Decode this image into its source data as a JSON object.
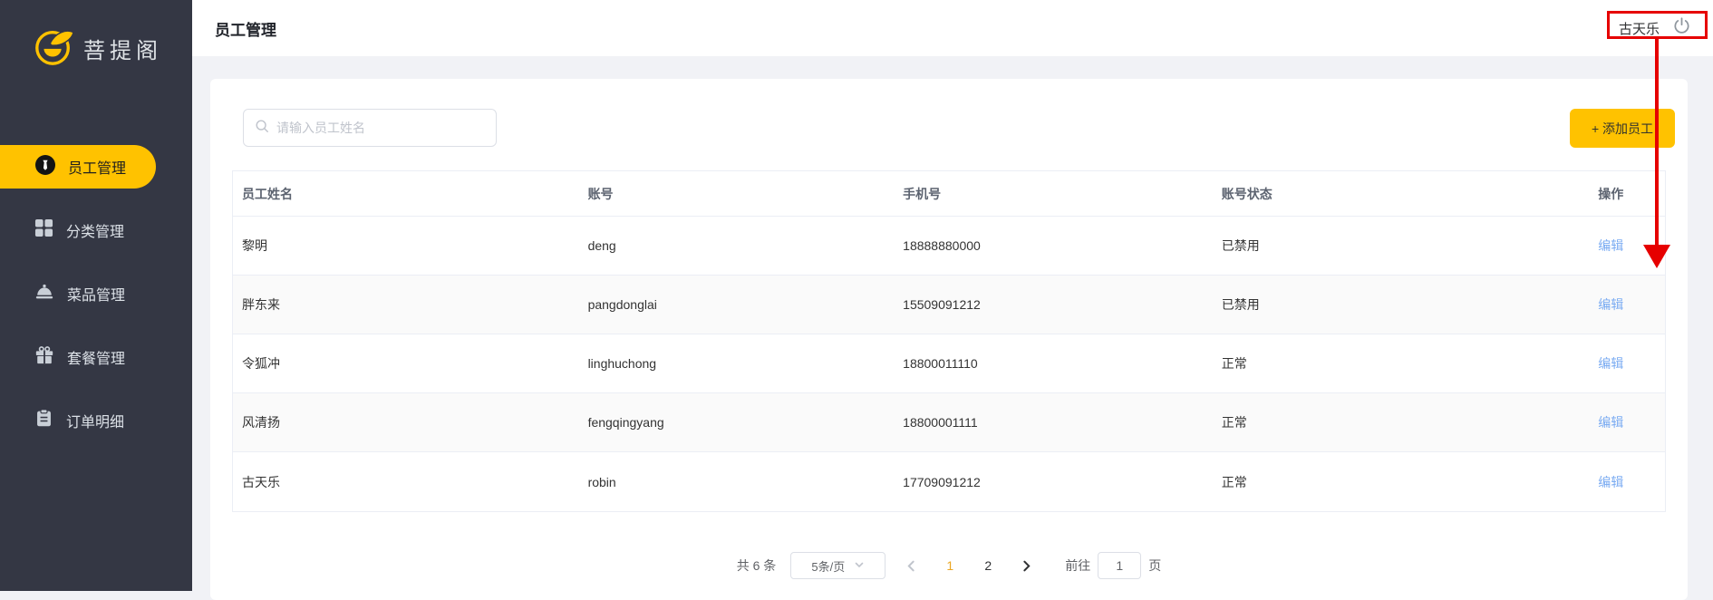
{
  "sidebar": {
    "logo_text": "菩提阁",
    "items": [
      {
        "label": "员工管理",
        "icon": "employee-icon",
        "active": true
      },
      {
        "label": "分类管理",
        "icon": "category-grid-icon",
        "active": false
      },
      {
        "label": "菜品管理",
        "icon": "dish-icon",
        "active": false
      },
      {
        "label": "套餐管理",
        "icon": "combo-gift-icon",
        "active": false
      },
      {
        "label": "订单明细",
        "icon": "order-clipboard-icon",
        "active": false
      }
    ]
  },
  "header": {
    "title": "员工管理",
    "user_name": "古天乐",
    "logout_icon": "power-icon"
  },
  "toolbar": {
    "search_placeholder": "请输入员工姓名",
    "search_icon": "search-icon",
    "add_button_label": "+ 添加员工"
  },
  "table": {
    "columns": [
      "员工姓名",
      "账号",
      "手机号",
      "账号状态",
      "操作"
    ],
    "rows": [
      {
        "name": "黎明",
        "account": "deng",
        "phone": "18888880000",
        "status": "已禁用",
        "action": "编辑"
      },
      {
        "name": "胖东来",
        "account": "pangdonglai",
        "phone": "15509091212",
        "status": "已禁用",
        "action": "编辑"
      },
      {
        "name": "令狐冲",
        "account": "linghuchong",
        "phone": "18800011110",
        "status": "正常",
        "action": "编辑"
      },
      {
        "name": "风清扬",
        "account": "fengqingyang",
        "phone": "18800001111",
        "status": "正常",
        "action": "编辑"
      },
      {
        "name": "古天乐",
        "account": "robin",
        "phone": "17709091212",
        "status": "正常",
        "action": "编辑"
      }
    ]
  },
  "pagination": {
    "total_label": "共 6 条",
    "page_size_label": "5条/页",
    "page_size_chevron_icon": "chevron-down-icon",
    "prev_icon": "chevron-left-icon",
    "next_icon": "chevron-right-icon",
    "pages": [
      "1",
      "2"
    ],
    "active_page": "1",
    "goto_label": "前往",
    "goto_value": "1",
    "goto_suffix": "页"
  },
  "annotation": {
    "type": "red-highlight-box-with-arrow",
    "color": "#e60000"
  },
  "colors": {
    "accent_yellow": "#ffc200",
    "sidebar_bg": "#343744",
    "link_blue": "#7aabf2",
    "active_page_orange": "#eba622",
    "annotation_red": "#e60000"
  }
}
